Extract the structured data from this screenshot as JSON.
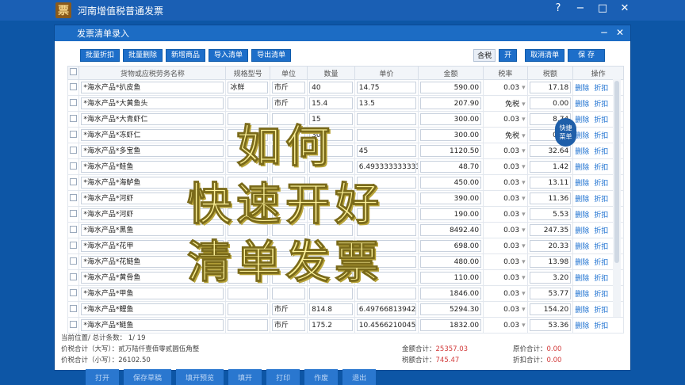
{
  "app": {
    "title": "河南增值税普通发票",
    "logo": "票",
    "controls": [
      "?",
      "−",
      "□",
      "✕"
    ]
  },
  "dialog": {
    "title": "发票清单录入",
    "controls": [
      "−",
      "✕"
    ]
  },
  "toolbar": {
    "batch_discount": "批量折扣",
    "batch_delete": "批量删除",
    "add_item": "新增商品",
    "import_list": "导入清单",
    "export_list": "导出清单"
  },
  "rtoolbar": {
    "tax_included": "含税",
    "toggle": "开",
    "cancel_list": "取消清单",
    "save": "保 存"
  },
  "table": {
    "headers": [
      "货物或应税劳务名称",
      "规格型号",
      "单位",
      "数量",
      "单价",
      "金额",
      "税率",
      "税额",
      "操作"
    ],
    "delete_label": "删除",
    "discount_label": "折扣",
    "rows": [
      {
        "name": "*海水产品*扒皮鱼",
        "spec": "冰鲜",
        "unit": "市斤",
        "qty": "40",
        "price": "14.75",
        "amount": "590.00",
        "rate": "0.03",
        "tax": "17.18"
      },
      {
        "name": "*海水产品*大黄鱼头",
        "spec": "",
        "unit": "市斤",
        "qty": "15.4",
        "price": "13.5",
        "amount": "207.90",
        "rate": "免税",
        "tax": "0.00"
      },
      {
        "name": "*海水产品*大青虾仁",
        "spec": "",
        "unit": "",
        "qty": "15",
        "price": "",
        "amount": "300.00",
        "rate": "0.03",
        "tax": "8.74"
      },
      {
        "name": "*海水产品*冻虾仁",
        "spec": "",
        "unit": "",
        "qty": "300",
        "price": "",
        "amount": "300.00",
        "rate": "免税",
        "tax": "0.00"
      },
      {
        "name": "*海水产品*多宝鱼",
        "spec": "",
        "unit": "",
        "qty": "",
        "price": "45",
        "amount": "1120.50",
        "rate": "0.03",
        "tax": "32.64"
      },
      {
        "name": "*海水产品*鲑鱼",
        "spec": "",
        "unit": "",
        "qty": "",
        "price": "6.493333333333",
        "amount": "48.70",
        "rate": "0.03",
        "tax": "1.42"
      },
      {
        "name": "*海水产品*海鲈鱼",
        "spec": "",
        "unit": "",
        "qty": "",
        "price": "",
        "amount": "450.00",
        "rate": "0.03",
        "tax": "13.11"
      },
      {
        "name": "*海水产品*河虾",
        "spec": "",
        "unit": "",
        "qty": "",
        "price": "",
        "amount": "390.00",
        "rate": "0.03",
        "tax": "11.36"
      },
      {
        "name": "*海水产品*河虾",
        "spec": "",
        "unit": "",
        "qty": "",
        "price": "",
        "amount": "190.00",
        "rate": "0.03",
        "tax": "5.53"
      },
      {
        "name": "*海水产品*黑鱼",
        "spec": "",
        "unit": "",
        "qty": "",
        "price": "",
        "amount": "8492.40",
        "rate": "0.03",
        "tax": "247.35"
      },
      {
        "name": "*海水产品*花甲",
        "spec": "",
        "unit": "",
        "qty": "",
        "price": "71",
        "amount": "698.00",
        "rate": "0.03",
        "tax": "20.33"
      },
      {
        "name": "*海水产品*花鲢鱼",
        "spec": "",
        "unit": "",
        "qty": "",
        "price": "",
        "amount": "480.00",
        "rate": "0.03",
        "tax": "13.98"
      },
      {
        "name": "*海水产品*黄骨鱼",
        "spec": "",
        "unit": "",
        "qty": "",
        "price": "",
        "amount": "110.00",
        "rate": "0.03",
        "tax": "3.20"
      },
      {
        "name": "*海水产品*甲鱼",
        "spec": "",
        "unit": "",
        "qty": "",
        "price": "",
        "amount": "1846.00",
        "rate": "0.03",
        "tax": "53.77"
      },
      {
        "name": "*海水产品*鲤鱼",
        "spec": "",
        "unit": "市斤",
        "qty": "814.8",
        "price": "6.49766813942",
        "amount": "5294.30",
        "rate": "0.03",
        "tax": "154.20"
      },
      {
        "name": "*海水产品*鲢鱼",
        "spec": "",
        "unit": "市斤",
        "qty": "175.2",
        "price": "10.4566210045",
        "amount": "1832.00",
        "rate": "0.03",
        "tax": "53.36"
      }
    ]
  },
  "quick_menu": {
    "line1": "快捷",
    "line2": "菜单"
  },
  "footer": {
    "position": "当前位置/ 总计条数： 1/ 19",
    "total_upper_label": "价税合计（大写）：",
    "total_upper": "贰万陆仟壹佰零贰圆伍角整",
    "total_lower_label": "价税合计（小写）：",
    "total_lower": "26102.50",
    "amount_total_label": "金额合计：",
    "amount_total": "25357.03",
    "tax_total_label": "税额合计：",
    "tax_total": "745.47",
    "orig_total_label": "原价合计：",
    "orig_total": "0.00",
    "discount_total_label": "折扣合计：",
    "discount_total": "0.00"
  },
  "bottom_bar": [
    "打开",
    "保存草稿",
    "填开预览",
    "填开",
    "打印",
    "作废",
    "退出"
  ],
  "overlay": {
    "line1": "如何",
    "line2": "快速开好",
    "line3": "清单发票"
  }
}
